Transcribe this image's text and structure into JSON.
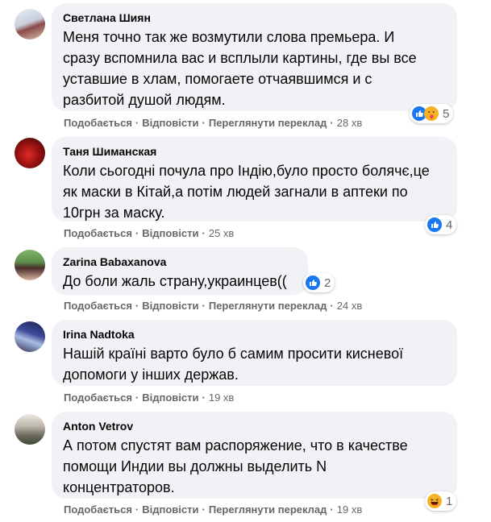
{
  "action_labels": {
    "like": "Подобається",
    "reply": "Відповісти",
    "see_translation": "Переглянути переклад",
    "separator": "·"
  },
  "comments": [
    {
      "author": "Светлана Шиян",
      "text": "Меня точно так же возмутили слова премьера. И\nсразу вспомнила вас и всплыли картины, где вы все\nуставшие в хлам, помогаете отчаявшимся и с\nразбитой душой людям.",
      "time": "28 хв",
      "reactions": [
        "like-icon",
        "care-icon"
      ],
      "reaction_count": "5",
      "avatar_colors": [
        "#cfd8e6",
        "#7a3b3b"
      ]
    },
    {
      "author": "Таня Шиманская",
      "text": "Коли сьогодні почула про Індію,було просто болячє,це\nяк маски в Кітай,а потім людей загнали в аптеки по\n10грн за маску.",
      "time": "25 хв",
      "reactions": [
        "like-icon"
      ],
      "reaction_count": "4",
      "avatar_colors": [
        "#b01c1c",
        "#3a0a0a"
      ]
    },
    {
      "author": "Zarina Babaxanova",
      "text": "До боли жаль страну,украинцев((",
      "time": "24 хв",
      "reactions": [
        "like-icon"
      ],
      "reaction_count": "2",
      "avatar_colors": [
        "#6ea35a",
        "#3b2a2a"
      ]
    },
    {
      "author": "Irina Nadtoka",
      "text": "Нашій країні варто було б самим просити кисневої\nдопомоги у інших держав.",
      "time": "19 хв",
      "reactions": [],
      "reaction_count": "",
      "avatar_colors": [
        "#2b2f6e",
        "#9fb2d8"
      ]
    },
    {
      "author": "Anton Vetrov",
      "text": "А потом спустят вам распоряжение, что в качестве\nпомощи Индии вы должны выделить N\nконцентраторов.",
      "time": "19 хв",
      "reactions": [
        "haha-icon"
      ],
      "reaction_count": "1",
      "avatar_colors": [
        "#c9c4bc",
        "#5d5a4e"
      ]
    }
  ]
}
